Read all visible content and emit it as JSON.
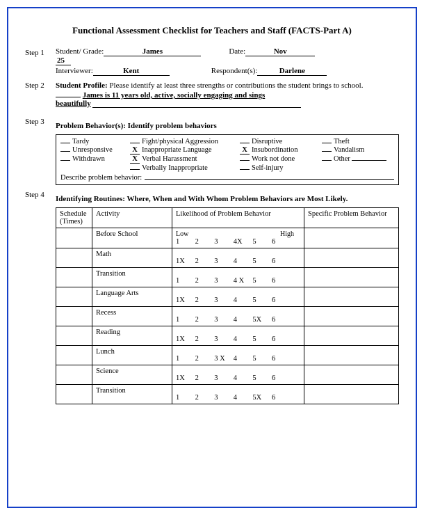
{
  "title": "Functional Assessment Checklist for Teachers and Staff (FACTS-Part A)",
  "steps": {
    "s1": "Step 1",
    "s2": "Step 2",
    "s3": "Step 3",
    "s4": "Step 4"
  },
  "fields": {
    "student_grade_label": "Student/ Grade:",
    "student_grade_value": "James",
    "date_label": "Date:",
    "date_value": "Nov",
    "date_value2": "25",
    "interviewer_label": "Interviewer:",
    "interviewer_value": "Kent",
    "respondent_label": "Respondent(s):",
    "respondent_value": "Darlene"
  },
  "profile": {
    "lead": "Student Profile:",
    "prompt": " Please identify at least three strengths or contributions the student brings to school.",
    "answer1": "James is 11 years old, active, socially engaging and sings",
    "answer2": "beautifully"
  },
  "behaviors_header": "Problem Behavior(s):  Identify problem behaviors",
  "behaviors": {
    "tardy": "Tardy",
    "unresponsive": "Unresponsive",
    "withdrawn": "Withdrawn",
    "fight": "Fight/physical Aggression",
    "inapp_lang": "Inappropriate Language",
    "verbal_har": "Verbal Harassment",
    "verbally_inapp": "Verbally Inappropriate",
    "disruptive": "Disruptive",
    "insub": "Insubordination",
    "work_not_done": "Work not done",
    "self_injury": "Self-injury",
    "theft": "Theft",
    "vandalism": "Vandalism",
    "other": "Other",
    "x": "X",
    "describe_label": "Describe problem behavior:"
  },
  "routines_header": "Identifying Routines: Where, When and With Whom Problem Behaviors are Most Likely.",
  "routines_table": {
    "col_schedule": "Schedule (Times)",
    "col_activity": "Activity",
    "col_likelihood": "Likelihood of Problem Behavior",
    "col_specific": "Specific Problem Behavior",
    "low": "Low",
    "high": "High",
    "rows": [
      {
        "activity": "Before School",
        "marks": [
          "1",
          "2",
          "3",
          "4X",
          "5",
          "6"
        ]
      },
      {
        "activity": "Math",
        "marks": [
          "1X",
          "2",
          "3",
          "4",
          "5",
          "6"
        ]
      },
      {
        "activity": "Transition",
        "marks": [
          "1",
          "2",
          "3",
          "4 X",
          "5",
          "6"
        ]
      },
      {
        "activity": "Language Arts",
        "marks": [
          "1X",
          "2",
          "3",
          "4",
          "5",
          "6"
        ]
      },
      {
        "activity": "Recess",
        "marks": [
          "1",
          "2",
          "3",
          "4",
          "5X",
          "6"
        ]
      },
      {
        "activity": "Reading",
        "marks": [
          "1X",
          "2",
          "3",
          "4",
          "5",
          "6"
        ]
      },
      {
        "activity": "Lunch",
        "marks": [
          "1",
          "2",
          "3 X",
          "4",
          "5",
          "6"
        ]
      },
      {
        "activity": "Science",
        "marks": [
          "1X",
          "2",
          "3",
          "4",
          "5",
          "6"
        ]
      },
      {
        "activity": "Transition",
        "marks": [
          "1",
          "2",
          "3",
          "4",
          "5X",
          "6"
        ]
      }
    ]
  }
}
